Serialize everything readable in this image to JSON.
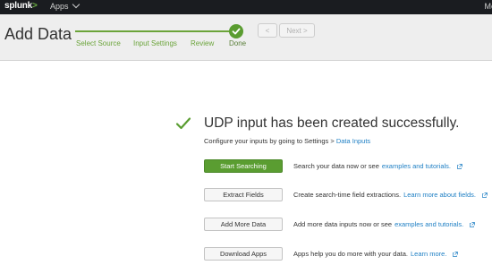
{
  "topbar": {
    "logo_text": "splunk",
    "logo_chevron": ">",
    "apps_label": "Apps",
    "user_label": "Me"
  },
  "header": {
    "title": "Add Data",
    "steps": [
      {
        "label": "Select Source"
      },
      {
        "label": "Input Settings"
      },
      {
        "label": "Review"
      },
      {
        "label": "Done"
      }
    ],
    "prev_label": "<",
    "next_label": "Next >"
  },
  "main": {
    "success_title": "UDP input has been created successfully.",
    "configure_prefix": "Configure your inputs by going to Settings > ",
    "configure_link": "Data Inputs",
    "actions": [
      {
        "button": "Start Searching",
        "text": "Search your data now or see ",
        "link": "examples and tutorials."
      },
      {
        "button": "Extract Fields",
        "text": "Create search-time field extractions. ",
        "link": "Learn more about fields."
      },
      {
        "button": "Add More Data",
        "text": "Add more data inputs now or see ",
        "link": "examples and tutorials."
      },
      {
        "button": "Download Apps",
        "text": "Apps help you do more with your data. ",
        "link": "Learn more."
      }
    ]
  },
  "colors": {
    "accent_green": "#5a9d31",
    "link_blue": "#1e7fc4",
    "topbar_bg": "#1a1c20"
  }
}
